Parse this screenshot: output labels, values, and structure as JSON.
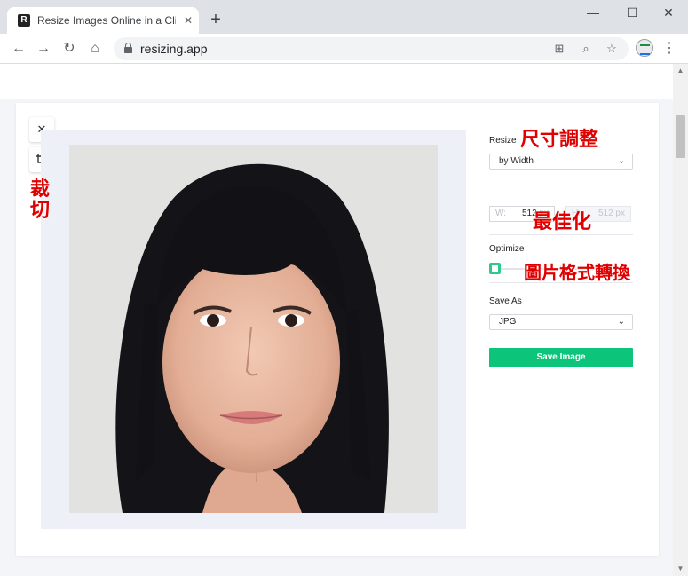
{
  "browser": {
    "tab_title": "Resize Images Online in a Click",
    "tab_favicon_letter": "R",
    "url": "resizing.app"
  },
  "editor": {
    "resize_label": "Resize",
    "resize_mode": "by Width",
    "width_key": "W:",
    "width_value": "512 px",
    "height_key": "H:",
    "height_value": "512 px",
    "optimize_label": "Optimize",
    "optimize_level": 0,
    "save_as_label": "Save As",
    "format": "JPG",
    "save_button": "Save Image"
  },
  "annotations": {
    "resize_note": "尺寸調整",
    "crop_note": "裁切",
    "optimize_note": "最佳化",
    "format_note": "圖片格式轉換"
  },
  "colors": {
    "accent_green": "#0cc47a",
    "annotation_red": "#e00000"
  },
  "icons": [
    "favicon-icon",
    "tab-close-icon",
    "new-tab-icon",
    "minimize-icon",
    "maximize-icon",
    "window-close-icon",
    "back-icon",
    "forward-icon",
    "reload-icon",
    "home-icon",
    "lock-icon",
    "translate-icon",
    "zoom-icon",
    "star-icon",
    "extension-icon",
    "menu-icon",
    "close-icon",
    "crop-icon",
    "chevron-down-icon"
  ]
}
